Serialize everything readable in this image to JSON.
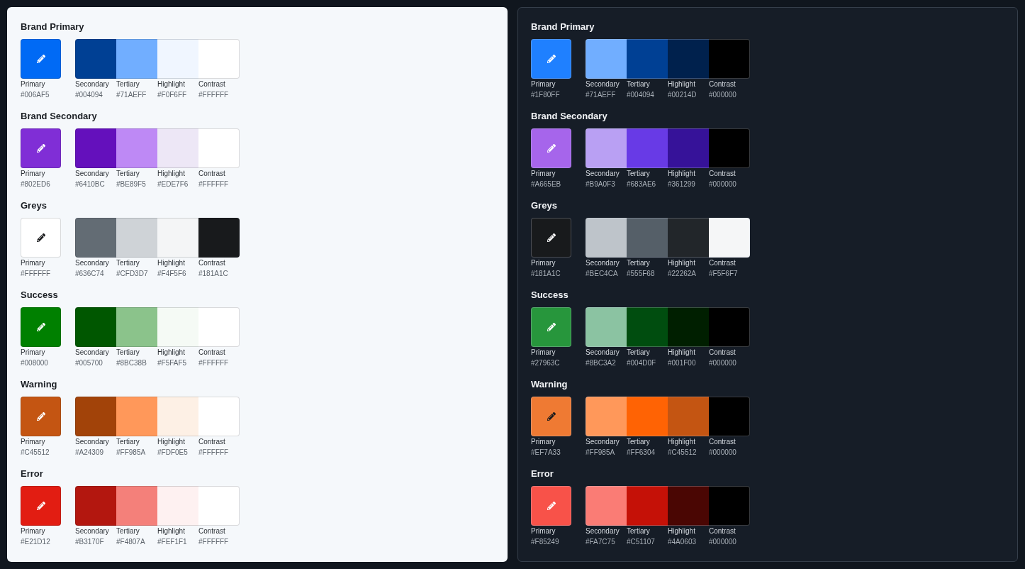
{
  "panels": [
    {
      "kind": "light",
      "groups": [
        {
          "title": "Brand Primary",
          "primary": {
            "label": "Primary",
            "hex": "#006AF5",
            "color": "#006af5",
            "dark_icon": false
          },
          "shades": [
            {
              "label": "Secondary",
              "hex": "#004094",
              "color": "#004094"
            },
            {
              "label": "Tertiary",
              "hex": "#71AEFF",
              "color": "#71aeff"
            },
            {
              "label": "Highlight",
              "hex": "#F0F6FF",
              "color": "#f0f6ff"
            },
            {
              "label": "Contrast",
              "hex": "#FFFFFF",
              "color": "#ffffff"
            }
          ]
        },
        {
          "title": "Brand Secondary",
          "primary": {
            "label": "Primary",
            "hex": "#802ED6",
            "color": "#802ed6",
            "dark_icon": false
          },
          "shades": [
            {
              "label": "Secondary",
              "hex": "#6410BC",
              "color": "#6410bc"
            },
            {
              "label": "Tertiary",
              "hex": "#BE89F5",
              "color": "#be89f5"
            },
            {
              "label": "Highlight",
              "hex": "#EDE7F6",
              "color": "#ede7f6"
            },
            {
              "label": "Contrast",
              "hex": "#FFFFFF",
              "color": "#ffffff"
            }
          ]
        },
        {
          "title": "Greys",
          "primary": {
            "label": "Primary",
            "hex": "#FFFFFF",
            "color": "#ffffff",
            "dark_icon": true
          },
          "shades": [
            {
              "label": "Secondary",
              "hex": "#636C74",
              "color": "#636c74"
            },
            {
              "label": "Tertiary",
              "hex": "#CFD3D7",
              "color": "#cfd3d7"
            },
            {
              "label": "Highlight",
              "hex": "#F4F5F6",
              "color": "#f4f5f6"
            },
            {
              "label": "Contrast",
              "hex": "#181A1C",
              "color": "#181a1c"
            }
          ]
        },
        {
          "title": "Success",
          "primary": {
            "label": "Primary",
            "hex": "#008000",
            "color": "#008000",
            "dark_icon": false
          },
          "shades": [
            {
              "label": "Secondary",
              "hex": "#005700",
              "color": "#005700"
            },
            {
              "label": "Tertiary",
              "hex": "#8BC38B",
              "color": "#8bc38b"
            },
            {
              "label": "Highlight",
              "hex": "#F5FAF5",
              "color": "#f5faf5"
            },
            {
              "label": "Contrast",
              "hex": "#FFFFFF",
              "color": "#ffffff"
            }
          ]
        },
        {
          "title": "Warning",
          "primary": {
            "label": "Primary",
            "hex": "#C45512",
            "color": "#c45512",
            "dark_icon": false
          },
          "shades": [
            {
              "label": "Secondary",
              "hex": "#A24309",
              "color": "#a24309"
            },
            {
              "label": "Tertiary",
              "hex": "#FF985A",
              "color": "#ff985a"
            },
            {
              "label": "Highlight",
              "hex": "#FDF0E5",
              "color": "#fdf0e5"
            },
            {
              "label": "Contrast",
              "hex": "#FFFFFF",
              "color": "#ffffff"
            }
          ]
        },
        {
          "title": "Error",
          "primary": {
            "label": "Primary",
            "hex": "#E21D12",
            "color": "#e21d12",
            "dark_icon": false
          },
          "shades": [
            {
              "label": "Secondary",
              "hex": "#B3170F",
              "color": "#b3170f"
            },
            {
              "label": "Tertiary",
              "hex": "#F4807A",
              "color": "#f4807a"
            },
            {
              "label": "Highlight",
              "hex": "#FEF1F1",
              "color": "#fef1f1"
            },
            {
              "label": "Contrast",
              "hex": "#FFFFFF",
              "color": "#ffffff"
            }
          ]
        }
      ]
    },
    {
      "kind": "dark",
      "groups": [
        {
          "title": "Brand Primary",
          "primary": {
            "label": "Primary",
            "hex": "#1F80FF",
            "color": "#1f80ff",
            "dark_icon": false
          },
          "shades": [
            {
              "label": "Secondary",
              "hex": "#71AEFF",
              "color": "#71aeff"
            },
            {
              "label": "Tertiary",
              "hex": "#004094",
              "color": "#004094"
            },
            {
              "label": "Highlight",
              "hex": "#00214D",
              "color": "#00214d"
            },
            {
              "label": "Contrast",
              "hex": "#000000",
              "color": "#000000"
            }
          ]
        },
        {
          "title": "Brand Secondary",
          "primary": {
            "label": "Primary",
            "hex": "#A665EB",
            "color": "#a665eb",
            "dark_icon": false
          },
          "shades": [
            {
              "label": "Secondary",
              "hex": "#B9A0F3",
              "color": "#b9a0f3"
            },
            {
              "label": "Tertiary",
              "hex": "#683AE6",
              "color": "#683ae6"
            },
            {
              "label": "Highlight",
              "hex": "#361299",
              "color": "#361299"
            },
            {
              "label": "Contrast",
              "hex": "#000000",
              "color": "#000000"
            }
          ]
        },
        {
          "title": "Greys",
          "primary": {
            "label": "Primary",
            "hex": "#181A1C",
            "color": "#181a1c",
            "dark_icon": false
          },
          "shades": [
            {
              "label": "Secondary",
              "hex": "#BEC4CA",
              "color": "#bec4ca"
            },
            {
              "label": "Tertiary",
              "hex": "#555F68",
              "color": "#555f68"
            },
            {
              "label": "Highlight",
              "hex": "#22262A",
              "color": "#22262a"
            },
            {
              "label": "Contrast",
              "hex": "#F5F6F7",
              "color": "#f5f6f7"
            }
          ]
        },
        {
          "title": "Success",
          "primary": {
            "label": "Primary",
            "hex": "#27963C",
            "color": "#27963c",
            "dark_icon": false
          },
          "shades": [
            {
              "label": "Secondary",
              "hex": "#8BC3A2",
              "color": "#8bc3a2"
            },
            {
              "label": "Tertiary",
              "hex": "#004D0F",
              "color": "#004d0f"
            },
            {
              "label": "Highlight",
              "hex": "#001F00",
              "color": "#001f00"
            },
            {
              "label": "Contrast",
              "hex": "#000000",
              "color": "#000000"
            }
          ]
        },
        {
          "title": "Warning",
          "primary": {
            "label": "Primary",
            "hex": "#EF7A33",
            "color": "#ef7a33",
            "dark_icon": true
          },
          "shades": [
            {
              "label": "Secondary",
              "hex": "#FF985A",
              "color": "#ff985a"
            },
            {
              "label": "Tertiary",
              "hex": "#FF6304",
              "color": "#ff6304"
            },
            {
              "label": "Highlight",
              "hex": "#C45512",
              "color": "#c45512"
            },
            {
              "label": "Contrast",
              "hex": "#000000",
              "color": "#000000"
            }
          ]
        },
        {
          "title": "Error",
          "primary": {
            "label": "Primary",
            "hex": "#F85249",
            "color": "#f85249",
            "dark_icon": false
          },
          "shades": [
            {
              "label": "Secondary",
              "hex": "#FA7C75",
              "color": "#fa7c75"
            },
            {
              "label": "Tertiary",
              "hex": "#C51107",
              "color": "#c51107"
            },
            {
              "label": "Highlight",
              "hex": "#4A0603",
              "color": "#4a0603"
            },
            {
              "label": "Contrast",
              "hex": "#000000",
              "color": "#000000"
            }
          ]
        }
      ]
    }
  ]
}
